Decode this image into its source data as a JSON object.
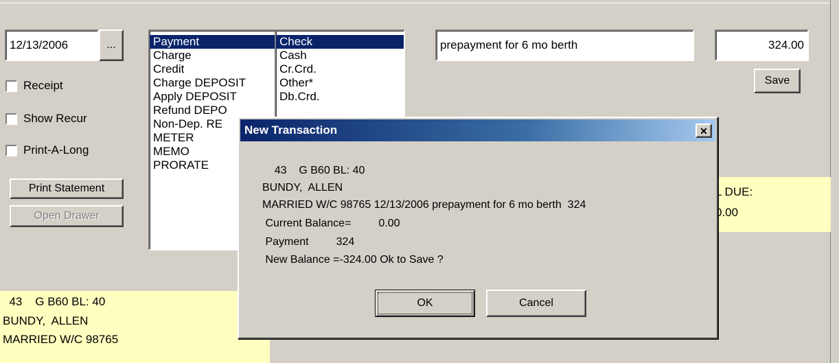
{
  "date": {
    "value": "12/13/2006",
    "picker_label": "..."
  },
  "checkboxes": [
    {
      "label": "Receipt"
    },
    {
      "label": "Show Recur"
    },
    {
      "label": "Print-A-Long"
    }
  ],
  "buttons": {
    "print_statement": "Print Statement",
    "open_drawer": "Open Drawer",
    "save": "Save"
  },
  "transaction_types": [
    "Payment",
    "Charge",
    "Credit",
    "Charge DEPOSIT",
    "Apply DEPOSIT",
    "Refund DEPO",
    "Non-Dep. RE",
    "METER",
    "MEMO",
    "PRORATE"
  ],
  "payment_methods": [
    "Check",
    "Cash",
    "Cr.Crd.",
    "Other*",
    "Db.Crd."
  ],
  "description": {
    "value": "prepayment for 6 mo berth"
  },
  "amount": {
    "value": "324.00"
  },
  "total_due": {
    "label": "L DUE:",
    "value": "0.00"
  },
  "customer_info": [
    "  43    G B60 BL: 40",
    "BUNDY,  ALLEN",
    "MARRIED W/C 98765"
  ],
  "dialog": {
    "title": "New Transaction",
    "close_glyph": "✕",
    "lines": [
      "    43    G B60 BL: 40",
      "BUNDY,  ALLEN",
      "MARRIED W/C 98765 12/13/2006 prepayment for 6 mo berth  324",
      " Current Balance=         0.00",
      " Payment         324",
      " New Balance =-324.00 Ok to Save ?"
    ],
    "ok_label": "OK",
    "cancel_label": "Cancel"
  }
}
